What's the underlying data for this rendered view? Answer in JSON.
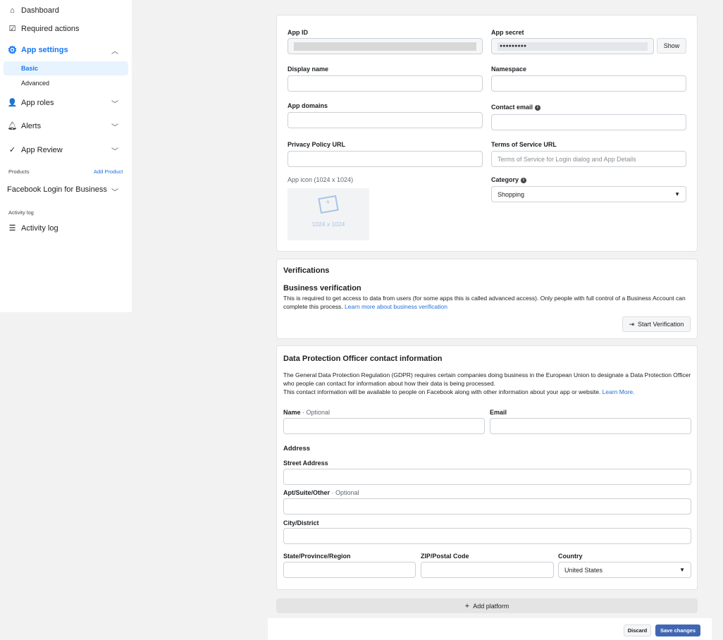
{
  "sidebar": {
    "dashboard": "Dashboard",
    "required_actions": "Required actions",
    "app_settings": "App settings",
    "basic": "Basic",
    "advanced": "Advanced",
    "app_roles": "App roles",
    "alerts": "Alerts",
    "app_review": "App Review",
    "products": "Products",
    "add_product": "Add Product",
    "fb_login": "Facebook Login for Business",
    "activity_log_header": "Activity log",
    "activity_log": "Activity log"
  },
  "basic": {
    "app_id": "App ID",
    "app_secret": "App secret",
    "secret_value": "●●●●●●●●●",
    "show": "Show",
    "display_name": "Display name",
    "namespace": "Namespace",
    "app_domains": "App domains",
    "contact_email": "Contact email",
    "privacy_url": "Privacy Policy URL",
    "tos_url": "Terms of Service URL",
    "tos_placeholder": "Terms of Service for Login dialog and App Details",
    "app_icon": "App icon (1024 x 1024)",
    "icon_size": "1024 x 1024",
    "category": "Category",
    "category_value": "Shopping"
  },
  "verifications": {
    "title": "Verifications",
    "subtitle": "Business verification",
    "text": "This is required to get access to data from users (for some apps this is called advanced access). Only people with full control of a Business Account can complete this process. ",
    "link": "Learn more about business verification",
    "button": "Start Verification"
  },
  "dpo": {
    "title": "Data Protection Officer contact information",
    "text1": "The General Data Protection Regulation (GDPR) requires certain companies doing business in the European Union to designate a Data Protection Officer who people can contact for information about how their data is being processed.",
    "text2": "This contact information will be available to people on Facebook along with other information about your app or website. ",
    "learn_more": "Learn More.",
    "name": "Name",
    "optional": " · Optional",
    "email": "Email",
    "address": "Address",
    "street": "Street Address",
    "apt": "Apt/Suite/Other",
    "apt_optional": " · Optional",
    "city": "City/District",
    "state": "State/Province/Region",
    "zip": "ZIP/Postal Code",
    "country": "Country",
    "country_value": "United States"
  },
  "footer": {
    "add_platform": "Add platform",
    "discard": "Discard",
    "save": "Save changes"
  },
  "colors": {
    "accent": "#1877f2",
    "save": "#4267b2"
  }
}
